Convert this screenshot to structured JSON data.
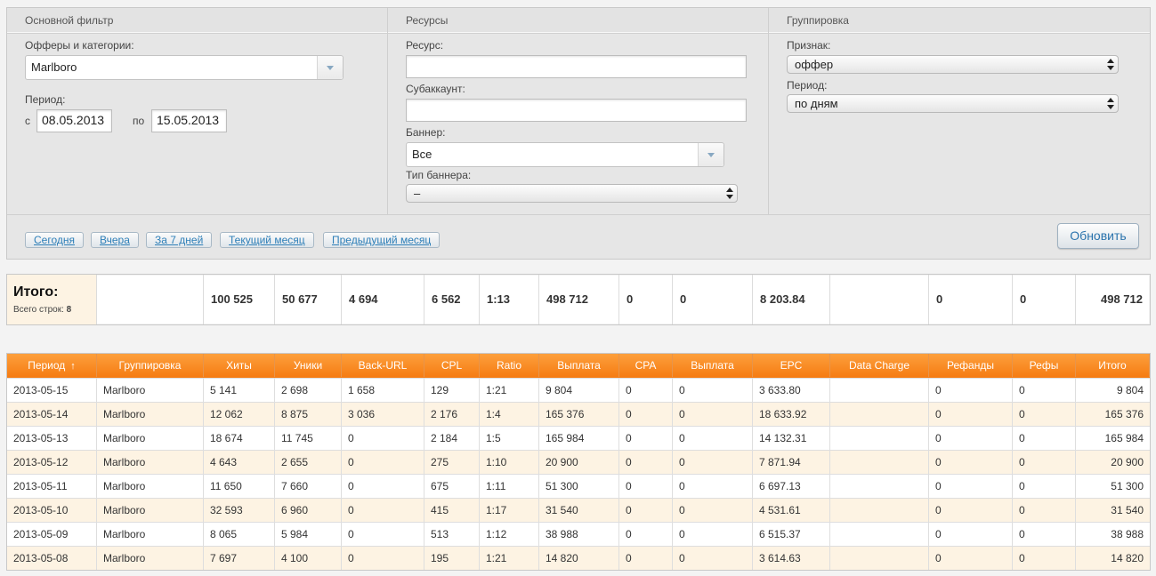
{
  "filter": {
    "main": {
      "title": "Основной фильтр",
      "offers_label": "Офферы и категории:",
      "offers_value": "Marlboro",
      "period_label": "Период:",
      "from_label": "с",
      "from_value": "08.05.2013",
      "to_label": "по",
      "to_value": "15.05.2013"
    },
    "resources": {
      "title": "Ресурсы",
      "resource_label": "Ресурс:",
      "resource_value": "",
      "subaccount_label": "Субаккаунт:",
      "subaccount_value": "",
      "banner_label": "Баннер:",
      "banner_value": "Все",
      "banner_type_label": "Тип баннера:",
      "banner_type_value": "–"
    },
    "grouping": {
      "title": "Группировка",
      "sign_label": "Признак:",
      "sign_value": "оффер",
      "period_label": "Период:",
      "period_value": "по дням"
    },
    "quick_periods": [
      "Сегодня",
      "Вчера",
      "За 7 дней",
      "Текущий месяц",
      "Предыдущий месяц"
    ],
    "refresh_label": "Обновить"
  },
  "totals": {
    "title": "Итого:",
    "rows_label": "Всего строк:",
    "rows_count": "8",
    "values": [
      "",
      "100 525",
      "50 677",
      "4 694",
      "6 562",
      "1:13",
      "498 712",
      "0",
      "0",
      "8 203.84",
      "",
      "0",
      "0",
      "498 712"
    ]
  },
  "table": {
    "columns": [
      "Период",
      "Группировка",
      "Хиты",
      "Уники",
      "Back-URL",
      "CPL",
      "Ratio",
      "Выплата",
      "CPA",
      "Выплата",
      "EPC",
      "Data Charge",
      "Рефанды",
      "Рефы",
      "Итого"
    ],
    "sort_indicator": "↑",
    "rows": [
      [
        "2013-05-15",
        "Marlboro",
        "5 141",
        "2 698",
        "1 658",
        "129",
        "1:21",
        "9 804",
        "0",
        "0",
        "3 633.80",
        "",
        "0",
        "0",
        "9 804"
      ],
      [
        "2013-05-14",
        "Marlboro",
        "12 062",
        "8 875",
        "3 036",
        "2 176",
        "1:4",
        "165 376",
        "0",
        "0",
        "18 633.92",
        "",
        "0",
        "0",
        "165 376"
      ],
      [
        "2013-05-13",
        "Marlboro",
        "18 674",
        "11 745",
        "0",
        "2 184",
        "1:5",
        "165 984",
        "0",
        "0",
        "14 132.31",
        "",
        "0",
        "0",
        "165 984"
      ],
      [
        "2013-05-12",
        "Marlboro",
        "4 643",
        "2 655",
        "0",
        "275",
        "1:10",
        "20 900",
        "0",
        "0",
        "7 871.94",
        "",
        "0",
        "0",
        "20 900"
      ],
      [
        "2013-05-11",
        "Marlboro",
        "11 650",
        "7 660",
        "0",
        "675",
        "1:11",
        "51 300",
        "0",
        "0",
        "6 697.13",
        "",
        "0",
        "0",
        "51 300"
      ],
      [
        "2013-05-10",
        "Marlboro",
        "32 593",
        "6 960",
        "0",
        "415",
        "1:17",
        "31 540",
        "0",
        "0",
        "4 531.61",
        "",
        "0",
        "0",
        "31 540"
      ],
      [
        "2013-05-09",
        "Marlboro",
        "8 065",
        "5 984",
        "0",
        "513",
        "1:12",
        "38 988",
        "0",
        "0",
        "6 515.37",
        "",
        "0",
        "0",
        "38 988"
      ],
      [
        "2013-05-08",
        "Marlboro",
        "7 697",
        "4 100",
        "0",
        "195",
        "1:21",
        "14 820",
        "0",
        "0",
        "3 614.63",
        "",
        "0",
        "0",
        "14 820"
      ]
    ]
  },
  "colors": {
    "header_orange": "#f78a20",
    "row_alt": "#fdf3e3",
    "link_blue": "#2e7fb8"
  }
}
